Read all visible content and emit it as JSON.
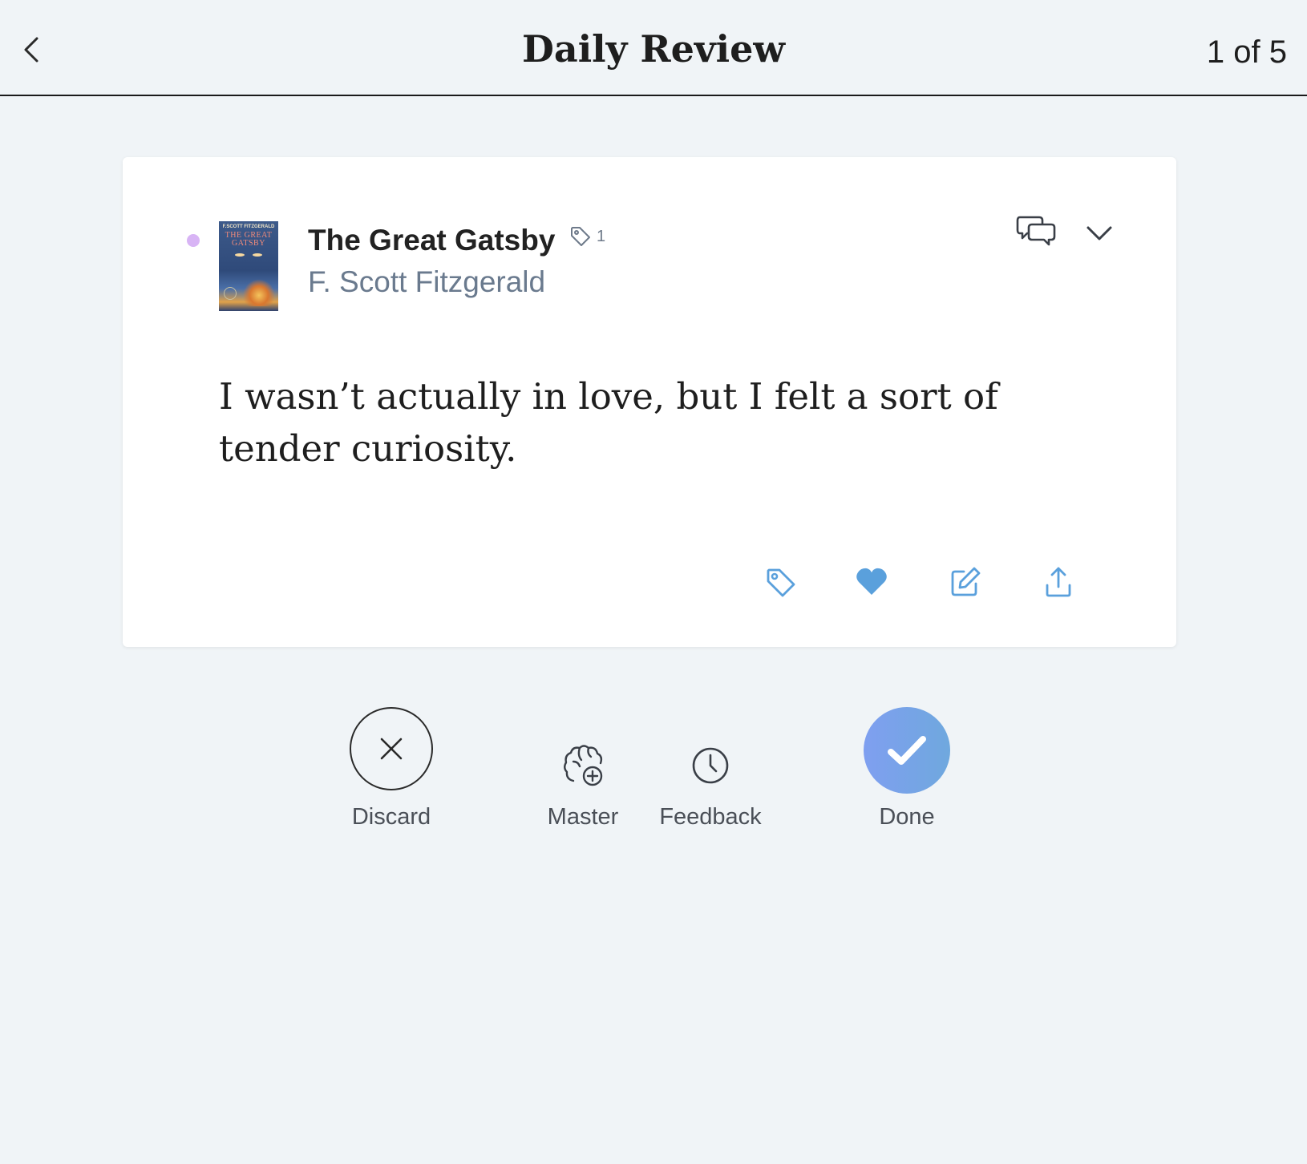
{
  "header": {
    "title": "Daily Review",
    "counter": "1 of 5"
  },
  "highlight": {
    "book_title": "The Great Gatsby",
    "tag_count": "1",
    "author": "F. Scott Fitzgerald",
    "cover": {
      "author_text": "F.SCOTT FITZGERALD",
      "title_text": "THE GREAT GATSBY"
    },
    "status_dot_color": "#d8b4f5",
    "quote": "I wasn’t actually in love, but I felt a sort of tender curiosity."
  },
  "card_actions": [
    "tag-icon",
    "heart-icon",
    "edit-icon",
    "share-icon"
  ],
  "bottom_actions": {
    "discard": "Discard",
    "master": "Master",
    "feedback": "Feedback",
    "done": "Done"
  },
  "colors": {
    "accent_blue": "#5aa0dc",
    "done_gradient_start": "#7f9ff0",
    "done_gradient_end": "#6fa8de",
    "background": "#f0f4f7"
  }
}
